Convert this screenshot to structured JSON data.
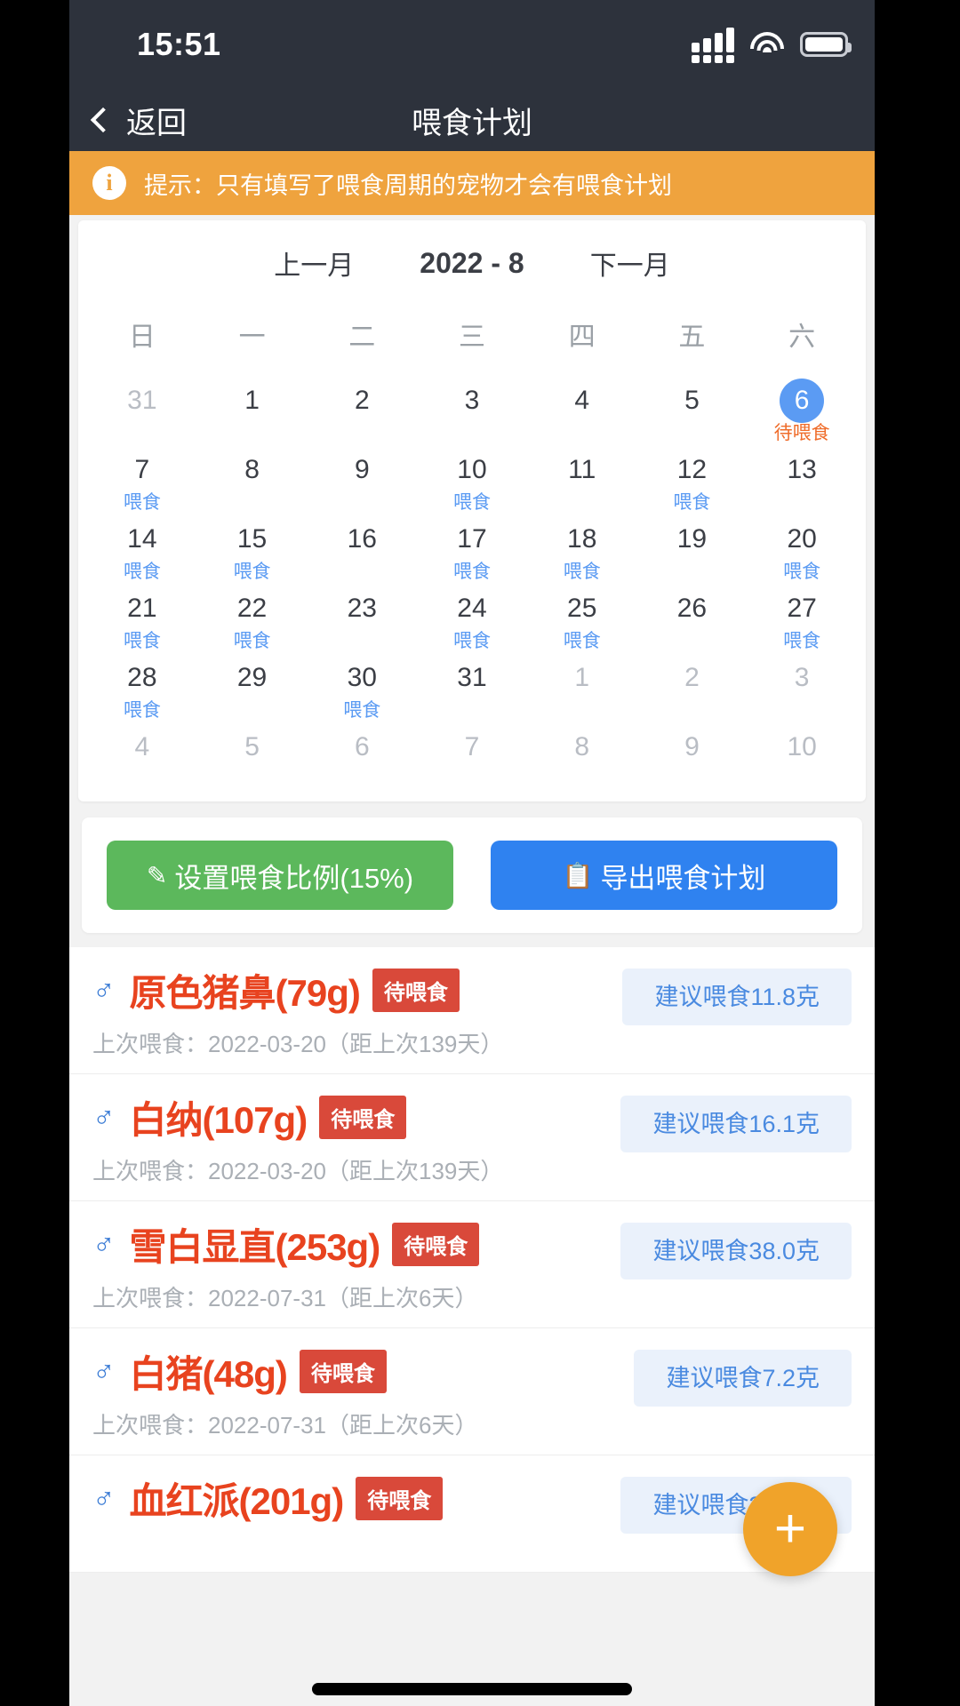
{
  "status_bar": {
    "time": "15:51",
    "signal_icon": "signal-bars-icon",
    "wifi_icon": "wifi-icon",
    "battery_icon": "battery-icon"
  },
  "nav": {
    "back_label": "返回",
    "back_icon": "chevron-left-icon",
    "title": "喂食计划"
  },
  "tip": {
    "icon": "info-icon",
    "text": "提示：只有填写了喂食周期的宠物才会有喂食计划",
    "bg": "#efa33e"
  },
  "calendar": {
    "prev_label": "上一月",
    "month_label": "2022 - 8",
    "next_label": "下一月",
    "weekdays": [
      "日",
      "一",
      "二",
      "三",
      "四",
      "五",
      "六"
    ],
    "selected_color": "#5b9bf3",
    "feed_tag": "喂食",
    "pending_tag": "待喂食",
    "days": [
      {
        "num": "31",
        "muted": true
      },
      {
        "num": "1"
      },
      {
        "num": "2"
      },
      {
        "num": "3"
      },
      {
        "num": "4"
      },
      {
        "num": "5"
      },
      {
        "num": "6",
        "selected": true,
        "tag": "待喂食",
        "tag_type": "warn"
      },
      {
        "num": "7",
        "tag": "喂食"
      },
      {
        "num": "8"
      },
      {
        "num": "9"
      },
      {
        "num": "10",
        "tag": "喂食"
      },
      {
        "num": "11"
      },
      {
        "num": "12",
        "tag": "喂食"
      },
      {
        "num": "13"
      },
      {
        "num": "14",
        "tag": "喂食"
      },
      {
        "num": "15",
        "tag": "喂食"
      },
      {
        "num": "16"
      },
      {
        "num": "17",
        "tag": "喂食"
      },
      {
        "num": "18",
        "tag": "喂食"
      },
      {
        "num": "19"
      },
      {
        "num": "20",
        "tag": "喂食"
      },
      {
        "num": "21",
        "tag": "喂食"
      },
      {
        "num": "22",
        "tag": "喂食"
      },
      {
        "num": "23"
      },
      {
        "num": "24",
        "tag": "喂食"
      },
      {
        "num": "25",
        "tag": "喂食"
      },
      {
        "num": "26"
      },
      {
        "num": "27",
        "tag": "喂食"
      },
      {
        "num": "28",
        "tag": "喂食"
      },
      {
        "num": "29"
      },
      {
        "num": "30",
        "tag": "喂食"
      },
      {
        "num": "31"
      },
      {
        "num": "1",
        "muted": true
      },
      {
        "num": "2",
        "muted": true
      },
      {
        "num": "3",
        "muted": true
      },
      {
        "num": "4",
        "muted": true
      },
      {
        "num": "5",
        "muted": true
      },
      {
        "num": "6",
        "muted": true
      },
      {
        "num": "7",
        "muted": true
      },
      {
        "num": "8",
        "muted": true
      },
      {
        "num": "9",
        "muted": true
      },
      {
        "num": "10",
        "muted": true
      }
    ]
  },
  "actions": {
    "ratio_button": {
      "icon": "pencil-icon",
      "label": "设置喂食比例(15%)",
      "color": "#5cb85c"
    },
    "export_button": {
      "icon": "clipboard-icon",
      "label": "导出喂食计划",
      "color": "#2f82f0"
    }
  },
  "pets": [
    {
      "gender_icon": "male-icon",
      "name": "原色猪鼻(79g)",
      "status": "待喂食",
      "last_feed": "上次喂食：2022-03-20（距上次139天）",
      "suggestion": "建议喂食11.8克"
    },
    {
      "gender_icon": "male-icon",
      "name": "白纳(107g)",
      "status": "待喂食",
      "last_feed": "上次喂食：2022-03-20（距上次139天）",
      "suggestion": "建议喂食16.1克"
    },
    {
      "gender_icon": "male-icon",
      "name": "雪白显直(253g)",
      "status": "待喂食",
      "last_feed": "上次喂食：2022-07-31（距上次6天）",
      "suggestion": "建议喂食38.0克"
    },
    {
      "gender_icon": "male-icon",
      "name": "白猪(48g)",
      "status": "待喂食",
      "last_feed": "上次喂食：2022-07-31（距上次6天）",
      "suggestion": "建议喂食7.2克"
    },
    {
      "gender_icon": "male-icon",
      "name": "血红派(201g)",
      "status": "待喂食",
      "last_feed": "",
      "suggestion": "建议喂食30.1克"
    }
  ],
  "fab": {
    "icon": "plus-icon",
    "label": "+",
    "color": "#f0a32a"
  }
}
